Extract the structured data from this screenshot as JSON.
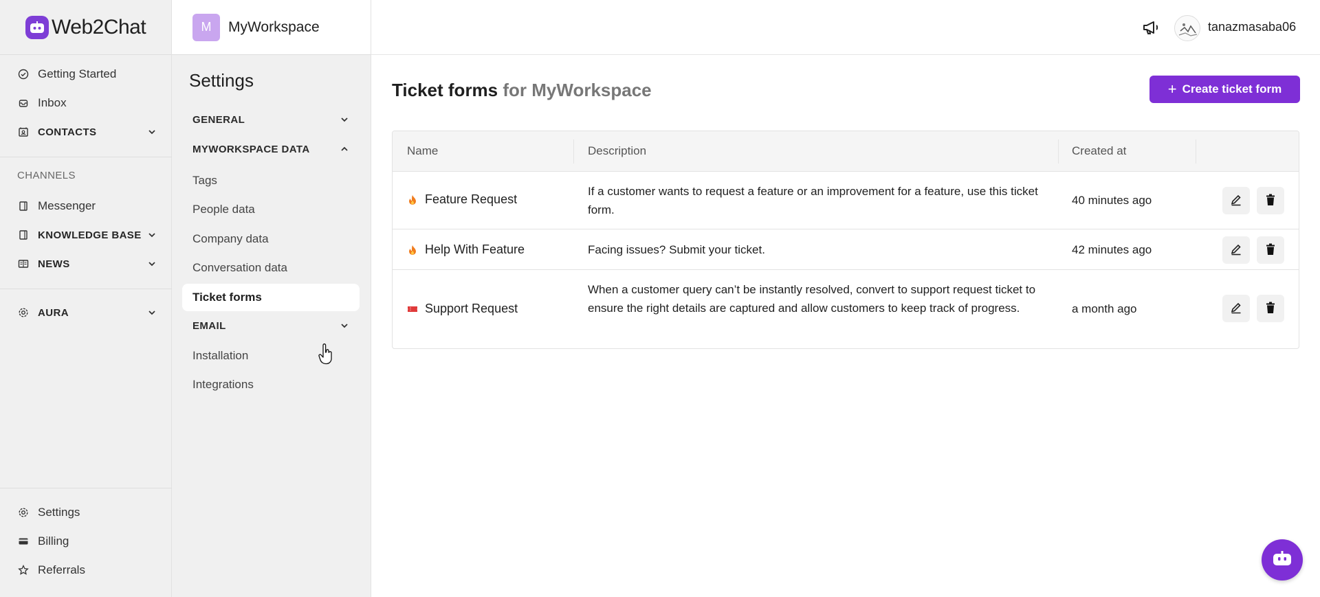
{
  "brand": {
    "name": "Web2Chat",
    "accent": "#7e2fd6"
  },
  "leftnav": {
    "items": [
      {
        "label": "Getting Started",
        "icon": "check-circle-icon"
      },
      {
        "label": "Inbox",
        "icon": "inbox-icon"
      },
      {
        "label": "CONTACTS",
        "icon": "contacts-icon"
      }
    ],
    "channels_heading": "CHANNELS",
    "channels": [
      {
        "label": "Messenger",
        "icon": "messenger-icon"
      },
      {
        "label": "KNOWLEDGE BASE",
        "icon": "book-icon"
      },
      {
        "label": "NEWS",
        "icon": "news-icon"
      }
    ],
    "aura": {
      "label": "AURA",
      "icon": "gear-icon"
    },
    "bottom": [
      {
        "label": "Settings",
        "icon": "gear-icon"
      },
      {
        "label": "Billing",
        "icon": "credit-card-icon"
      },
      {
        "label": "Referrals",
        "icon": "star-icon"
      }
    ]
  },
  "workspace": {
    "avatar_letter": "M",
    "name": "MyWorkspace"
  },
  "settings": {
    "title": "Settings",
    "sections": {
      "general": "GENERAL",
      "data": "MYWORKSPACE DATA",
      "email": "EMAIL"
    },
    "data_items": [
      "Tags",
      "People data",
      "Company data",
      "Conversation data",
      "Ticket forms"
    ],
    "other_items": [
      "Installation",
      "Integrations"
    ]
  },
  "topbar": {
    "username": "tanazmasaba06"
  },
  "main": {
    "title": "Ticket forms",
    "title_suffix": "for MyWorkspace",
    "create_label": "Create ticket form",
    "columns": [
      "Name",
      "Description",
      "Created at"
    ],
    "rows": [
      {
        "name": "Feature Request",
        "emoji": "fire-icon",
        "description": "If a customer wants to request a feature or an improvement for a feature, use this ticket form.",
        "created": "40 minutes ago"
      },
      {
        "name": "Help With Feature",
        "emoji": "fire-icon",
        "description": "Facing issues? Submit your ticket.",
        "created": "42 minutes ago"
      },
      {
        "name": "Support Request",
        "emoji": "ticket-icon",
        "description": "When a customer query can’t be instantly resolved, convert to support request ticket to ensure the right details are captured and allow customers to keep track of progress.",
        "created": "a month ago"
      }
    ]
  }
}
